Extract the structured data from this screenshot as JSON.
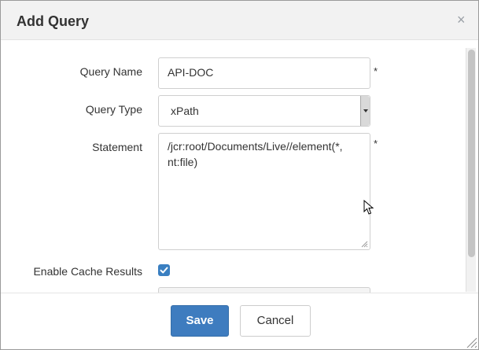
{
  "dialog": {
    "title": "Add Query",
    "close_glyph": "×"
  },
  "form": {
    "query_name": {
      "label": "Query Name",
      "value": "API-DOC",
      "required_mark": "*"
    },
    "query_type": {
      "label": "Query Type",
      "selected": "xPath"
    },
    "statement": {
      "label": "Statement",
      "value": "/jcr:root/Documents/Live//element(*,\nnt:file)",
      "required_mark": "*"
    },
    "enable_cache": {
      "label": "Enable Cache Results",
      "checked": true
    }
  },
  "footer": {
    "save_label": "Save",
    "cancel_label": "Cancel"
  },
  "colors": {
    "primary": "#3e7cbf",
    "checkbox": "#3a7fc1"
  }
}
